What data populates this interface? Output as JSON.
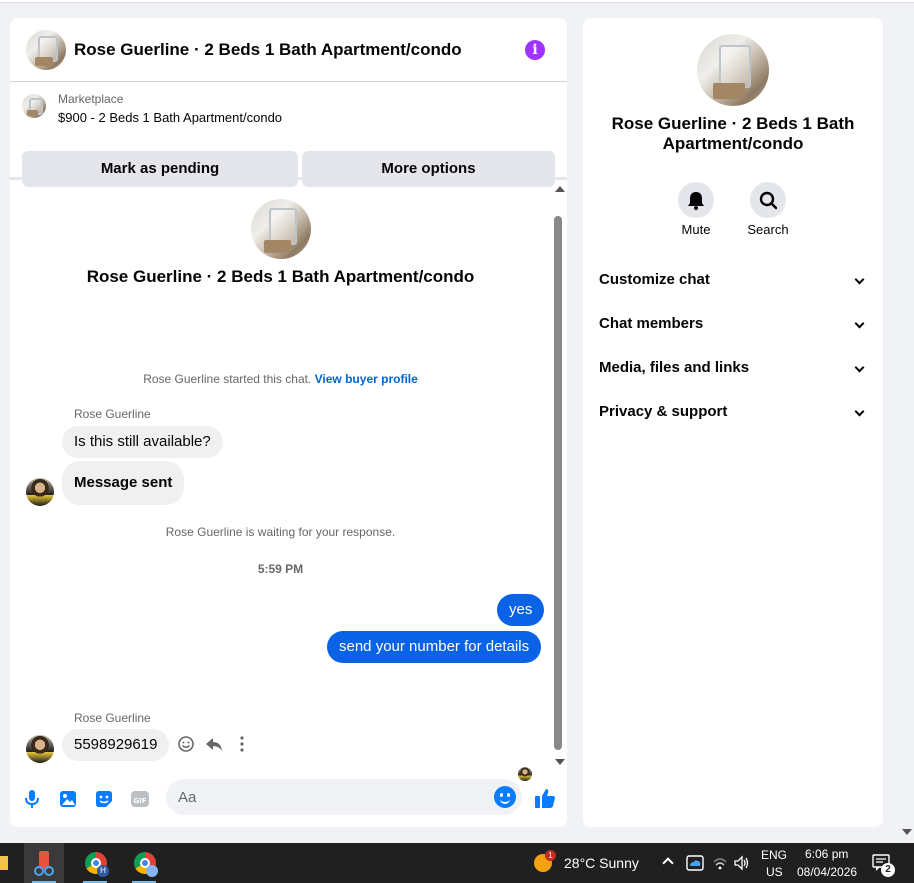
{
  "chat": {
    "title": "Rose Guerline · 2 Beds 1 Bath Apartment/condo",
    "info_icon": "info-icon"
  },
  "marketplace": {
    "label": "Marketplace",
    "detail": "$900 - 2 Beds 1 Bath Apartment/condo",
    "mark_pending": "Mark as pending",
    "more_options": "More options"
  },
  "conversation": {
    "title": "Rose Guerline · 2 Beds 1 Bath Apartment/condo",
    "started_text": "Rose Guerline started this chat.",
    "view_buyer_profile": "View buyer profile",
    "sender_name_1": "Rose Guerline",
    "messages_in_1": [
      "Is this still available?",
      "Message sent"
    ],
    "waiting_text": "Rose Guerline is waiting for your response.",
    "timestamp": "5:59 PM",
    "messages_out": [
      "yes",
      "send your number for details"
    ],
    "sender_name_2": "Rose Guerline",
    "message_in_2": "5598929619"
  },
  "composer": {
    "placeholder": "Aa",
    "icons": [
      "microphone-icon",
      "image-icon",
      "sticker-icon",
      "gif-icon",
      "emoji-icon",
      "thumbs-up-icon"
    ]
  },
  "right_panel": {
    "title": "Rose Guerline · 2 Beds 1 Bath Apartment/condo",
    "mute": "Mute",
    "search": "Search",
    "sections": [
      "Customize chat",
      "Chat members",
      "Media, files and links",
      "Privacy & support"
    ]
  },
  "taskbar": {
    "weather_badge": "1",
    "weather": "28°C  Sunny",
    "lang_1": "ENG",
    "lang_2": "US",
    "time": "6:06 pm",
    "date": "08/04/2026",
    "notifications": "2"
  },
  "colors": {
    "accent": "#0a62e7",
    "info": "#a033ff",
    "link": "#0064d1"
  }
}
